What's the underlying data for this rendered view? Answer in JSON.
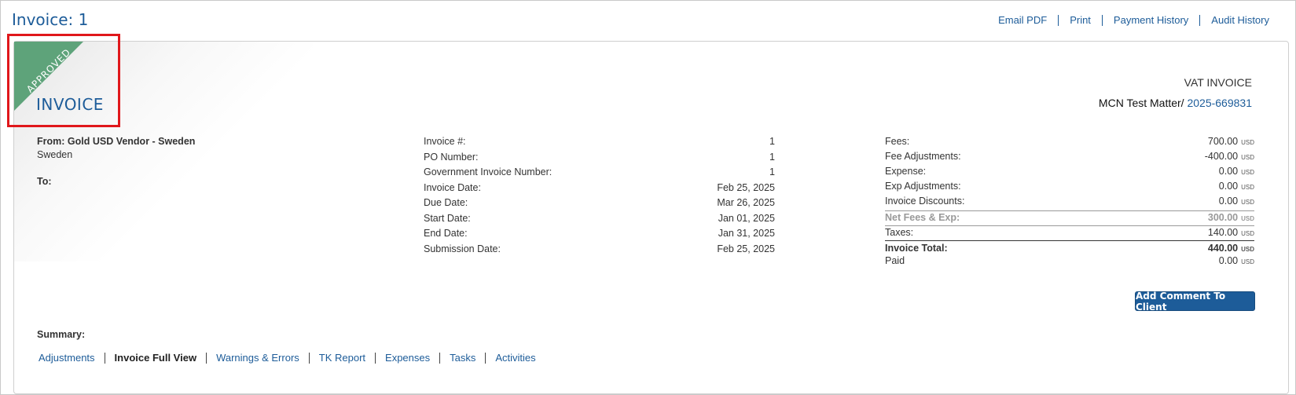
{
  "header": {
    "title": "Invoice: 1",
    "links": [
      "Email PDF",
      "Print",
      "Payment History",
      "Audit History"
    ]
  },
  "status": {
    "ribbon_label": "APPROVED",
    "ribbon_color": "#5ea37a",
    "heading": "INVOICE"
  },
  "invoice_type": "VAT INVOICE",
  "matter": {
    "name": "MCN Test Matter/",
    "number": "2025-669831"
  },
  "from": {
    "label": "From: Gold USD Vendor - Sweden",
    "country": "Sweden"
  },
  "to": {
    "label": "To:"
  },
  "details": [
    {
      "label": "Invoice #:",
      "value": "1"
    },
    {
      "label": "PO Number:",
      "value": "1"
    },
    {
      "label": "Government Invoice Number:",
      "value": "1"
    },
    {
      "label": "Invoice Date:",
      "value": "Feb 25, 2025"
    },
    {
      "label": "Due Date:",
      "value": "Mar 26, 2025"
    },
    {
      "label": "Start Date:",
      "value": "Jan 01, 2025"
    },
    {
      "label": "End Date:",
      "value": "Jan 31, 2025"
    },
    {
      "label": "Submission Date:",
      "value": "Feb 25, 2025"
    }
  ],
  "totals": [
    {
      "label": "Fees:",
      "value": "700.00",
      "currency": "USD"
    },
    {
      "label": "Fee Adjustments:",
      "value": "-400.00",
      "currency": "USD"
    },
    {
      "label": "Expense:",
      "value": "0.00",
      "currency": "USD"
    },
    {
      "label": "Exp Adjustments:",
      "value": "0.00",
      "currency": "USD"
    },
    {
      "label": "Invoice Discounts:",
      "value": "0.00",
      "currency": "USD"
    },
    {
      "label": "Net Fees & Exp:",
      "value": "300.00",
      "currency": "USD"
    },
    {
      "label": "Taxes:",
      "value": "140.00",
      "currency": "USD"
    },
    {
      "label": "Invoice Total:",
      "value": "440.00",
      "currency": "USD"
    },
    {
      "label": "Paid",
      "value": "0.00",
      "currency": "USD"
    }
  ],
  "actions": {
    "add_comment": "Add Comment To Client"
  },
  "summary": {
    "label": "Summary:",
    "tabs": [
      "Adjustments",
      "Invoice Full View",
      "Warnings & Errors",
      "TK Report",
      "Expenses",
      "Tasks",
      "Activities"
    ],
    "active_tab": "Invoice Full View"
  },
  "colors": {
    "link": "#1d5c99",
    "highlight": "#e0171b",
    "button": "#1d5c99"
  }
}
